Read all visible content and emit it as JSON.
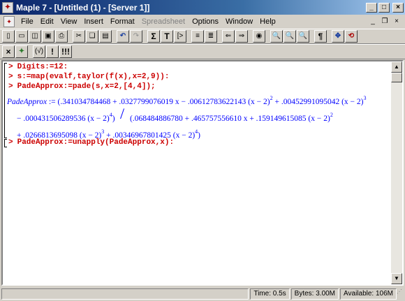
{
  "window": {
    "title": "Maple 7 - [Untitled (1) - [Server 1]]",
    "app_icon": "maple-leaf-icon"
  },
  "menu": {
    "items": [
      {
        "label": "File"
      },
      {
        "label": "Edit"
      },
      {
        "label": "View"
      },
      {
        "label": "Insert"
      },
      {
        "label": "Format"
      },
      {
        "label": "Spreadsheet",
        "disabled": true
      },
      {
        "label": "Options"
      },
      {
        "label": "Window"
      },
      {
        "label": "Help"
      }
    ]
  },
  "toolbar1": {
    "icons": [
      "new-icon",
      "open-icon",
      "open-url-icon",
      "save-icon",
      "print-icon",
      "cut-icon",
      "copy-icon",
      "paste-icon",
      "undo-icon",
      "redo-icon",
      "sigma-icon",
      "text-icon",
      "prompt-icon",
      "execution-group-icon",
      "section-icon",
      "back-icon",
      "forward-icon",
      "stop-icon",
      "zoom-100-icon",
      "zoom-200-icon",
      "zoom-400-icon",
      "pilcrow-icon",
      "expand-icon",
      "restart-icon"
    ]
  },
  "toolbar2": {
    "icons": [
      "close-icon",
      "maple-leaf-icon",
      "sqrt-icon",
      "exclamation-icon",
      "triple-exclamation-icon"
    ]
  },
  "worksheet": {
    "prompt": ">",
    "inputs": [
      "Digits:=12:",
      "s:=map(evalf,taylor(f(x),x=2,9)):",
      "PadeApprox:=pade(s,x=2,[4,4]);",
      "PadeApprox:=unapply(PadeApprox,x):"
    ],
    "output": {
      "lhs": "PadeApprox",
      "line1": ":= (.341034784468 + .0327799076019 x − .00612783622143 (x − 2)",
      "line1_exp1": "2",
      "line1_b": " + .00452991095042 (x − 2)",
      "line1_exp2": "3",
      "line2": "− .000431506289536 (x − 2)",
      "line2_exp": "4",
      "line2_close": ")",
      "line2_den": "(.068484886780 + .465757556610 x + .159149615085 (x − 2)",
      "line2_den_exp": "2",
      "line3": "+ .0266813695098 (x − 2)",
      "line3_exp1": "3",
      "line3_b": " + .00346967801425 (x − 2)",
      "line3_exp2": "4",
      "line3_close": ")"
    }
  },
  "status": {
    "time": "Time:   0.5s",
    "bytes": "Bytes: 3.00M",
    "available": "Available: 106M"
  }
}
